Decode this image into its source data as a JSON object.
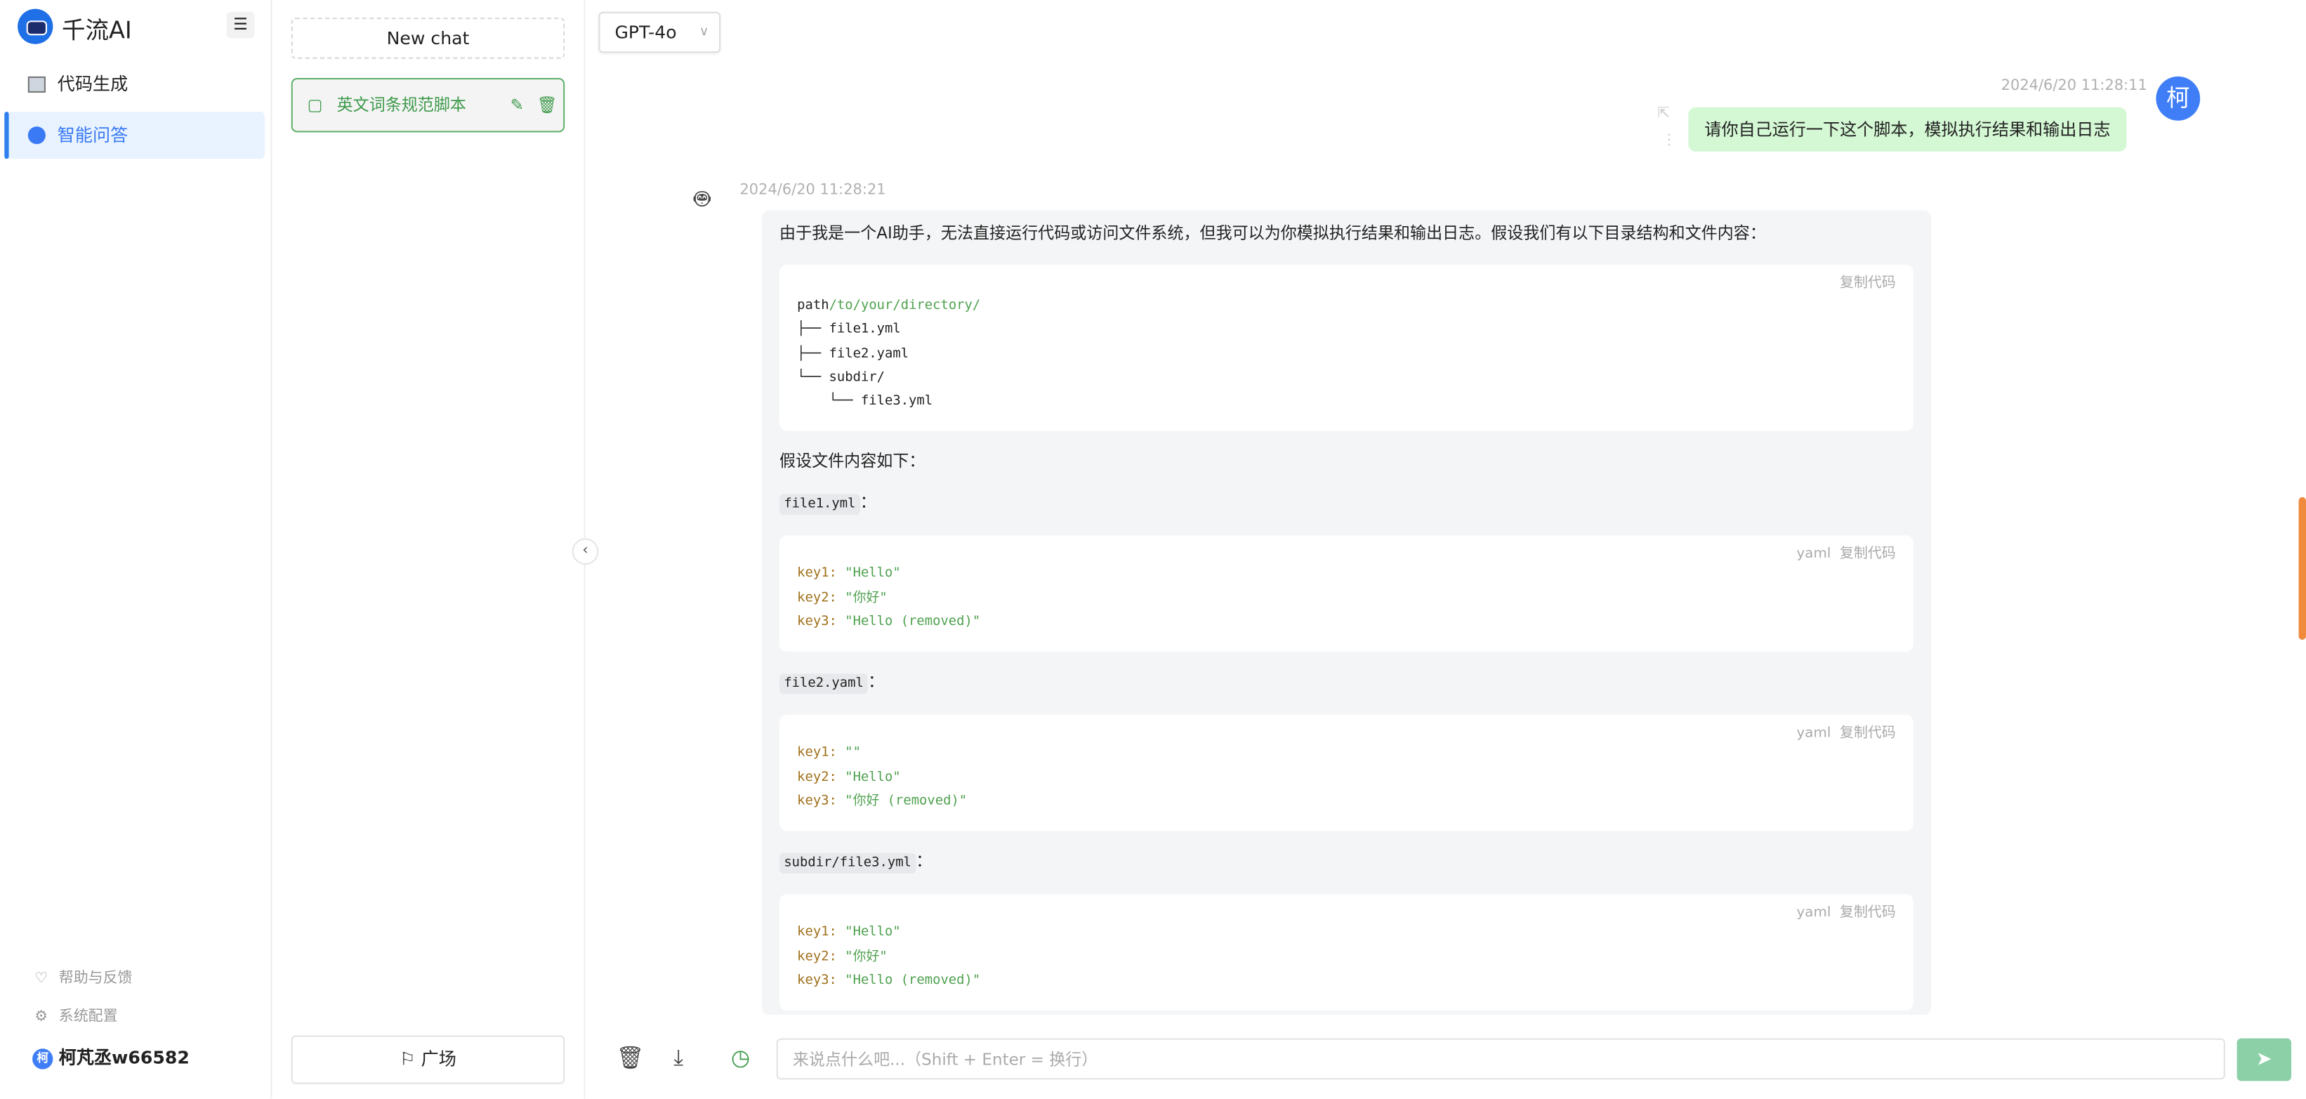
{
  "app": {
    "brand": "千流AI",
    "accent": "#2f80ed"
  },
  "sidebar": {
    "items": [
      {
        "label": "代码生成",
        "icon": "code-window-icon",
        "selected": false
      },
      {
        "label": "智能问答",
        "icon": "chat-bubble-icon",
        "selected": true
      }
    ],
    "footer": [
      {
        "label": "帮助与反馈",
        "icon": "lightbulb-icon"
      },
      {
        "label": "系统配置",
        "icon": "gear-icon"
      }
    ],
    "user": {
      "avatar": "柯",
      "name": "柯芃丞w66582"
    }
  },
  "chats": {
    "new_chat": "New chat",
    "items": [
      {
        "title": "英文词条规范脚本",
        "active": true
      }
    ],
    "plaza": "广场"
  },
  "model": {
    "selected": "GPT-4o"
  },
  "messages": {
    "user": {
      "time": "2024/6/20 11:28:11",
      "avatar": "柯",
      "text": "请你自己运行一下这个脚本，模拟执行结果和输出日志"
    },
    "bot": {
      "time": "2024/6/20 11:28:21",
      "intro": "由于我是一个AI助手，无法直接运行代码或访问文件系统，但我可以为你模拟执行结果和输出日志。假设我们有以下目录结构和文件内容：",
      "copy": "复制代码",
      "lang": "yaml",
      "tree": {
        "path_a": "path",
        "path_b": "/to/your/directory/",
        "lines": [
          "├── file1.yml",
          "├── file2.yaml",
          "└── subdir/",
          "    └── file3.yml"
        ]
      },
      "files_intro": "假设文件内容如下：",
      "files": [
        {
          "name": "file1.yml",
          "lines": [
            [
              "key1:",
              "\"Hello\""
            ],
            [
              "key2:",
              "\"你好\""
            ],
            [
              "key3:",
              "\"Hello (removed)\""
            ]
          ]
        },
        {
          "name": "file2.yaml",
          "lines": [
            [
              "key1:",
              "\"\""
            ],
            [
              "key2:",
              "\"Hello\""
            ],
            [
              "key3:",
              "\"你好 (removed)\""
            ]
          ]
        },
        {
          "name": "subdir/file3.yml",
          "lines": [
            [
              "key1:",
              "\"Hello\""
            ],
            [
              "key2:",
              "\"你好\""
            ],
            [
              "key3:",
              "\"Hello (removed)\""
            ]
          ]
        }
      ]
    }
  },
  "composer": {
    "placeholder": "来说点什么吧...（Shift + Enter = 换行）",
    "send_color": "#8cd0a8"
  }
}
